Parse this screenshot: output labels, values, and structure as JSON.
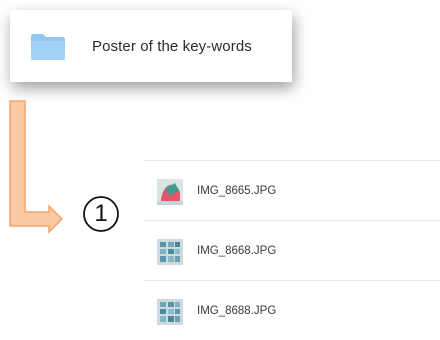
{
  "folder": {
    "name": "Poster of the key-words",
    "icon": "folder-icon",
    "icon_color": "#8ec8f3"
  },
  "annotation": {
    "arrow_color": "#f6a86b",
    "step_number": "1"
  },
  "files": [
    {
      "name": "IMG_8665.JPG",
      "icon": "image-thumbnail"
    },
    {
      "name": "IMG_8668.JPG",
      "icon": "image-thumbnail"
    },
    {
      "name": "IMG_8688.JPG",
      "icon": "image-thumbnail"
    }
  ]
}
